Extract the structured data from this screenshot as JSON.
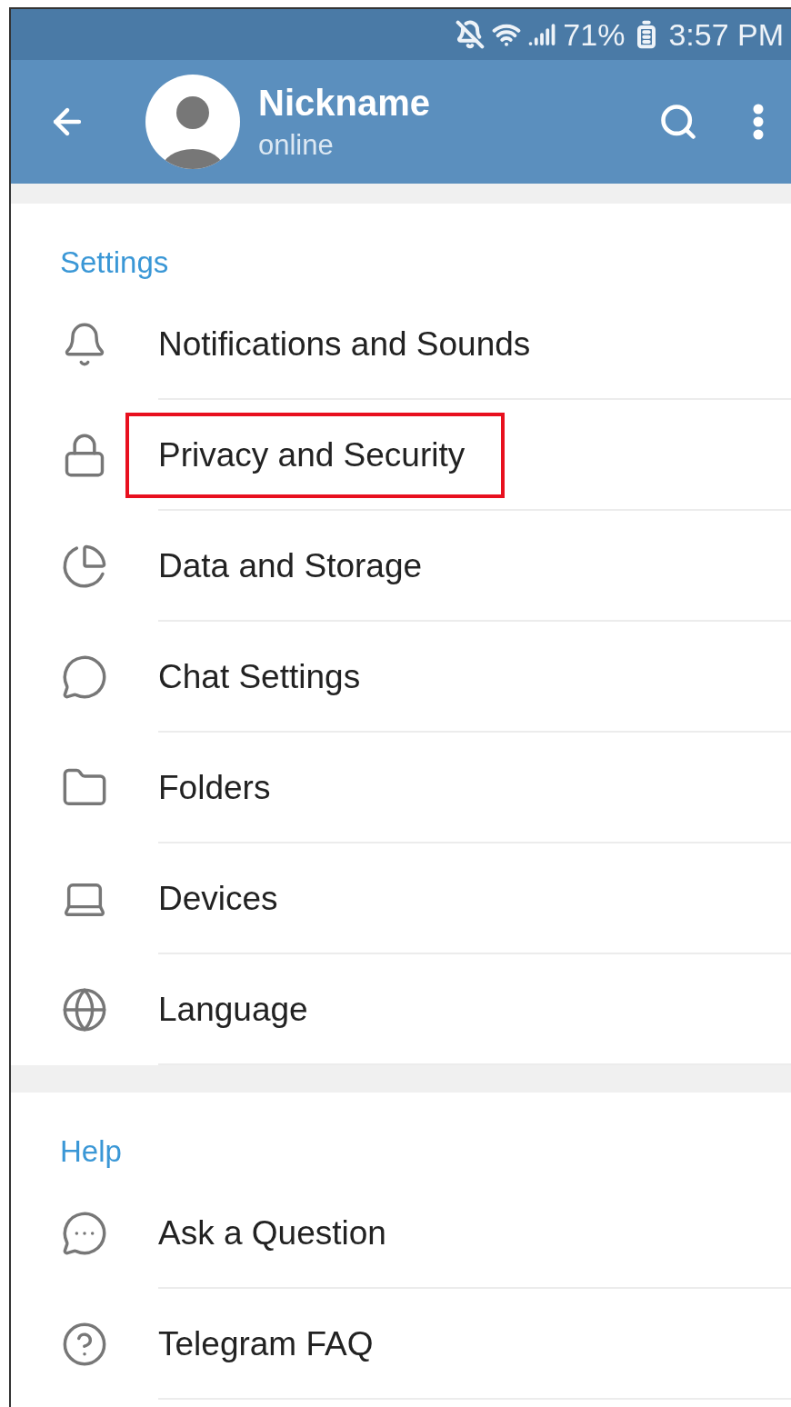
{
  "status_bar": {
    "battery": "71%",
    "time": "3:57 PM"
  },
  "header": {
    "title": "Nickname",
    "subtitle": "online"
  },
  "sections": [
    {
      "title": "Settings",
      "items": [
        {
          "label": "Notifications and Sounds",
          "highlighted": false
        },
        {
          "label": "Privacy and Security",
          "highlighted": true
        },
        {
          "label": "Data and Storage",
          "highlighted": false
        },
        {
          "label": "Chat Settings",
          "highlighted": false
        },
        {
          "label": "Folders",
          "highlighted": false
        },
        {
          "label": "Devices",
          "highlighted": false
        },
        {
          "label": "Language",
          "highlighted": false
        }
      ]
    },
    {
      "title": "Help",
      "items": [
        {
          "label": "Ask a Question",
          "highlighted": false
        },
        {
          "label": "Telegram FAQ",
          "highlighted": false
        }
      ]
    }
  ]
}
